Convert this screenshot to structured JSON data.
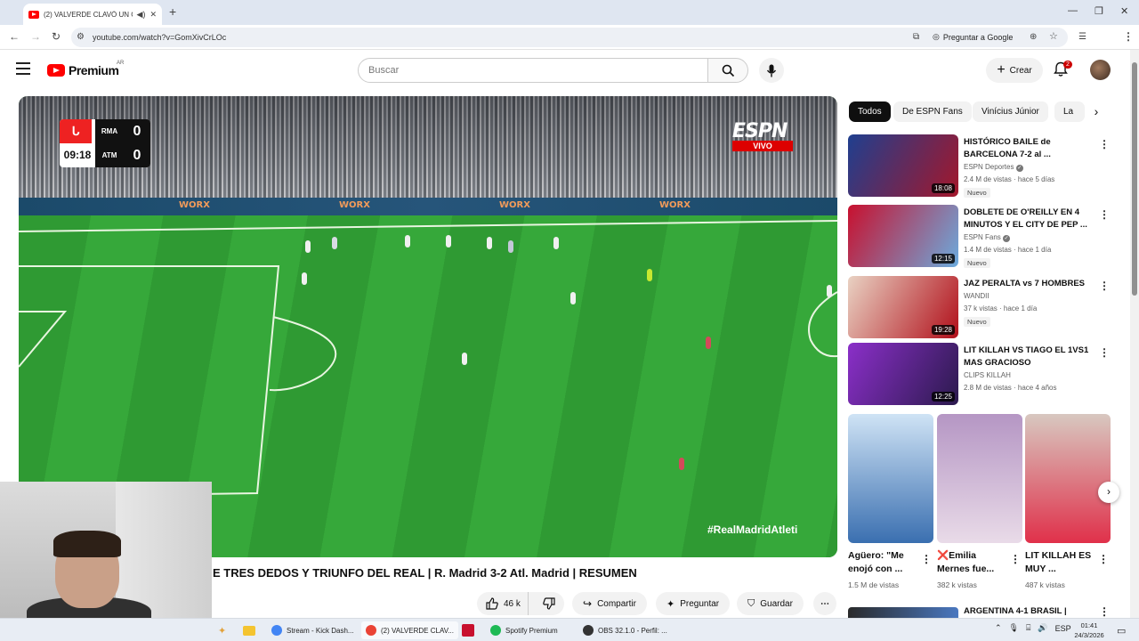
{
  "browser": {
    "tab_title": "(2) VALVERDE CLAVÓ UN G",
    "url": "youtube.com/watch?v=GomXivCrLOc",
    "ask_google": "Preguntar a Google"
  },
  "header": {
    "logo_text": "Premium",
    "country": "AR",
    "search_placeholder": "Buscar",
    "create_label": "Crear",
    "notification_count": "2"
  },
  "player": {
    "scoreboard": {
      "time": "09:18",
      "home_team": "RMA",
      "home_score": "0",
      "away_team": "ATM",
      "away_score": "0"
    },
    "broadcaster": "ESPN",
    "live_label": "VIVO",
    "board_text": "WORX",
    "hashtag": "#RealMadridAtleti"
  },
  "video": {
    "title": "E TRES DEDOS Y TRIUNFO DEL REAL | R. Madrid 3-2 Atl. Madrid | RESUMEN",
    "likes": "46 k",
    "share_label": "Compartir",
    "ask_label": "Preguntar",
    "save_label": "Guardar"
  },
  "chips": [
    "Todos",
    "De ESPN Fans",
    "Vinícius Júnior",
    "La"
  ],
  "recommendations": [
    {
      "title": "HISTÓRICO BAILE de BARCELONA 7-2 al ...",
      "channel": "ESPN Deportes",
      "meta": "2.4 M de vistas · hace 5 días",
      "badge": "Nuevo",
      "duration": "18:08",
      "verified": true,
      "thumb_colors": [
        "#1f3f8f",
        "#a3172b"
      ]
    },
    {
      "title": "DOBLETE DE O'REILLY EN 4 MINUTOS Y EL CITY DE PEP ...",
      "channel": "ESPN Fans",
      "meta": "1.4 M de vistas · hace 1 día",
      "badge": "Nuevo",
      "duration": "12:15",
      "verified": true,
      "thumb_colors": [
        "#c8102e",
        "#6cabdd"
      ]
    },
    {
      "title": "JAZ PERALTA vs 7 HOMBRES",
      "channel": "WANDII",
      "meta": "37 k vistas · hace 1 día",
      "badge": "Nuevo",
      "duration": "19:28",
      "verified": false,
      "thumb_colors": [
        "#e9d2c3",
        "#b10f1a"
      ]
    },
    {
      "title": "LIT KILLAH VS TIAGO EL 1VS1 MAS GRACIOSO",
      "channel": "CLIPS KILLAH",
      "meta": "2.8 M de vistas · hace 4 años",
      "badge": "",
      "duration": "12:25",
      "verified": false,
      "thumb_colors": [
        "#8b2fc9",
        "#2b1a4d"
      ]
    }
  ],
  "shorts": [
    {
      "title": "Agüero: \"Me enojó con ...",
      "views": "1.5 M de vistas",
      "thumb_colors": [
        "#cfe3f5",
        "#3a6fb0"
      ]
    },
    {
      "title": "❌Emilia Mernes fue...",
      "views": "382 k vistas",
      "thumb_colors": [
        "#b596c4",
        "#e9dbe8"
      ]
    },
    {
      "title": "LIT KILLAH ES MUY ...",
      "views": "487 k vistas",
      "thumb_colors": [
        "#d8c8c0",
        "#e0304a"
      ]
    }
  ],
  "next_recommendation": {
    "title": "ARGENTINA 4-1 BRASIL |"
  },
  "taskbar": {
    "apps": [
      {
        "label": "Stream - Kick Dash...",
        "color": "#4285f4"
      },
      {
        "label": "(2) VALVERDE CLAV...",
        "color": "#ea4335"
      },
      {
        "label": "Spotify Premium",
        "color": "#1db954"
      },
      {
        "label": "OBS 32.1.0 - Perfil: ...",
        "color": "#333333"
      }
    ],
    "lang": "ESP",
    "time": "01:41",
    "date": "24/3/2026"
  }
}
